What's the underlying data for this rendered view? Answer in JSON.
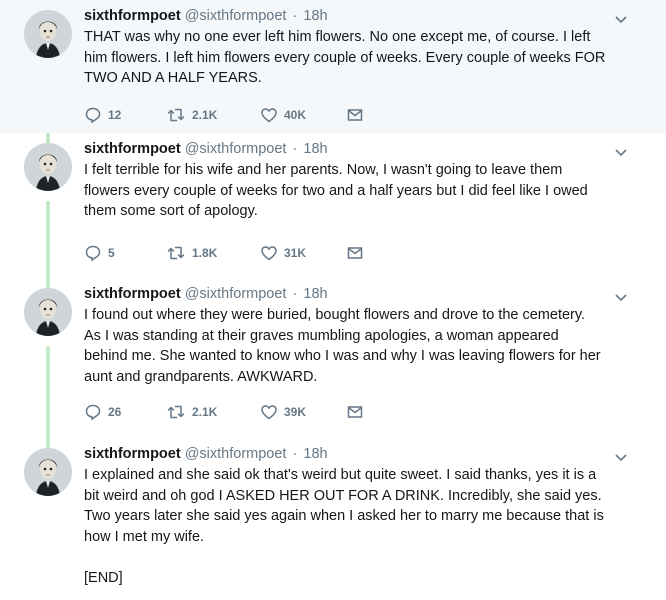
{
  "tweets": [
    {
      "display_name": "sixthformpoet",
      "handle": "@sixthformpoet",
      "separator": "·",
      "time": "18h",
      "text": "THAT was why no one ever left him flowers. No one except me, of course. I left\nhim flowers. I left him flowers every couple of weeks. Every couple of weeks FOR\nTWO AND A HALF YEARS.",
      "replies": "12",
      "retweets": "2.1K",
      "likes": "40K"
    },
    {
      "display_name": "sixthformpoet",
      "handle": "@sixthformpoet",
      "separator": "·",
      "time": "18h",
      "text": "I felt terrible for his wife and her parents. Now, I wasn't going to leave them\nflowers every couple of weeks for two and a half years but I did feel like I owed\nthem some sort of apology.",
      "replies": "5",
      "retweets": "1.8K",
      "likes": "31K"
    },
    {
      "display_name": "sixthformpoet",
      "handle": "@sixthformpoet",
      "separator": "·",
      "time": "18h",
      "text": "I found out where they were buried, bought flowers and drove to the cemetery.\nAs I was standing at their graves mumbling apologies, a woman appeared\nbehind me. She wanted to know who I was and why I was leaving flowers for her\naunt and grandparents. AWKWARD.",
      "replies": "26",
      "retweets": "2.1K",
      "likes": "39K"
    },
    {
      "display_name": "sixthformpoet",
      "handle": "@sixthformpoet",
      "separator": "·",
      "time": "18h",
      "text": "I explained and she said ok that's weird but quite sweet. I said thanks, yes it is a\nbit weird and oh god I ASKED HER OUT FOR A DRINK. Incredibly, she said yes.\nTwo years later she said yes again when I asked her to marry me because that is\nhow I met my wife.\n\n[END]"
    }
  ],
  "icons": {
    "reply": "reply-icon",
    "retweet": "retweet-icon",
    "like": "heart-icon",
    "dm": "envelope-icon",
    "more": "chevron-down-icon"
  },
  "colors": {
    "text": "#14171a",
    "muted": "#657786",
    "thread_line": "#c4e9c9",
    "highlight_bg": "#f5f8fa"
  }
}
